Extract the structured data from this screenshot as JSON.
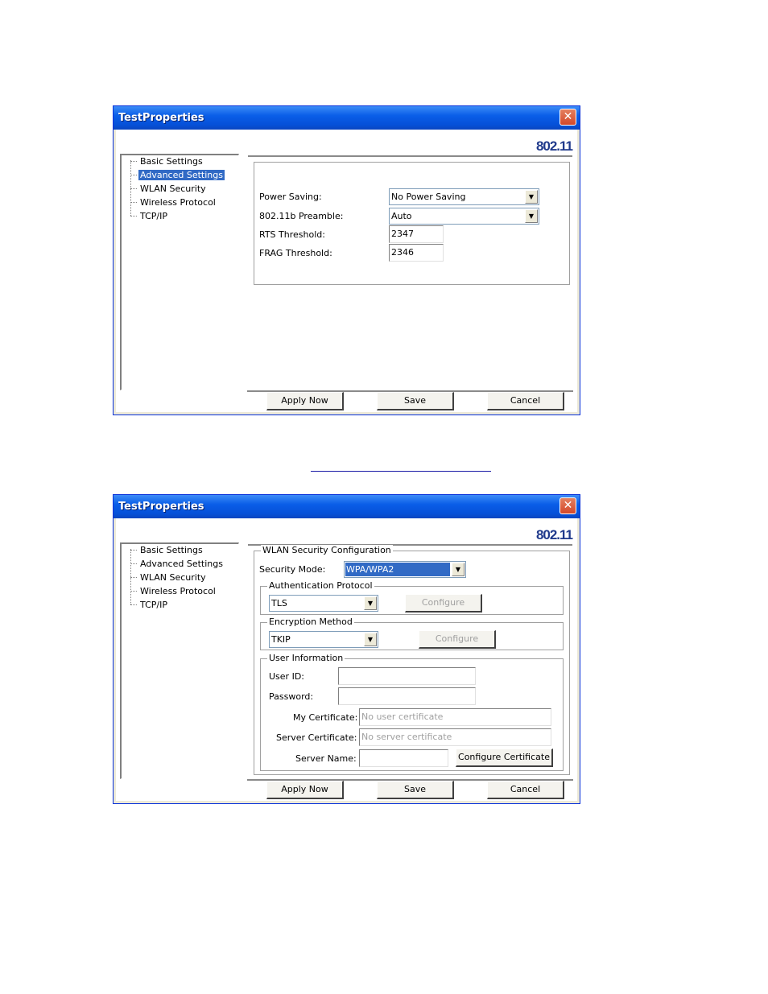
{
  "window1": {
    "title": "TestProperties",
    "brand": "802.11",
    "tree": [
      "Basic Settings",
      "Advanced Settings",
      "WLAN Security",
      "Wireless Protocol",
      "TCP/IP"
    ],
    "selected_tree_item": "Advanced Settings",
    "fields": {
      "power_saving_label": "Power Saving:",
      "power_saving_value": "No Power Saving",
      "preamble_label": "802.11b Preamble:",
      "preamble_value": "Auto",
      "rts_label": "RTS Threshold:",
      "rts_value": "2347",
      "frag_label": "FRAG Threshold:",
      "frag_value": "2346"
    },
    "buttons": {
      "apply": "Apply Now",
      "save": "Save",
      "cancel": "Cancel"
    }
  },
  "window2": {
    "title": "TestProperties",
    "brand": "802.11",
    "tree": [
      "Basic Settings",
      "Advanced Settings",
      "WLAN Security",
      "Wireless Protocol",
      "TCP/IP"
    ],
    "wlan_group": "WLAN Security Configuration",
    "security_mode_label": "Security Mode:",
    "security_mode_value": "WPA/WPA2",
    "auth_group": "Authentication Protocol",
    "auth_value": "TLS",
    "auth_configure": "Configure",
    "enc_group": "Encryption Method",
    "enc_value": "TKIP",
    "enc_configure": "Configure",
    "user_group": "User Information",
    "user_id_label": "User ID:",
    "password_label": "Password:",
    "my_cert_label": "My Certificate:",
    "my_cert_placeholder": "No user certificate",
    "server_cert_label": "Server Certificate:",
    "server_cert_placeholder": "No server certificate",
    "server_name_label": "Server Name:",
    "configure_certificate": "Configure Certificate",
    "buttons": {
      "apply": "Apply Now",
      "save": "Save",
      "cancel": "Cancel"
    }
  },
  "colors": {
    "titlebar": "#0a5ee8",
    "selection": "#316ac5",
    "brand": "#203a8c"
  }
}
